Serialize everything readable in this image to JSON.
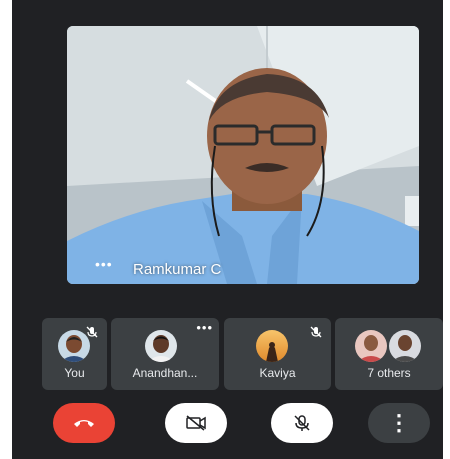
{
  "main_video": {
    "participant_name": "Ramkumar C",
    "more_label": "•••"
  },
  "participants": [
    {
      "name": "You",
      "status": "muted"
    },
    {
      "name": "Anandhan...",
      "status": "options"
    },
    {
      "name": "Kaviya",
      "status": "muted"
    },
    {
      "name": "7 others",
      "status": "group"
    }
  ],
  "controls": {
    "end_call_icon": "phone-hangup-icon",
    "camera_icon": "video-off-icon",
    "mic_icon": "mic-off-icon",
    "more_label": "⋮"
  },
  "colors": {
    "background": "#202124",
    "tile": "#3c4043",
    "end_call": "#ea4335",
    "control_light": "#ffffff"
  }
}
